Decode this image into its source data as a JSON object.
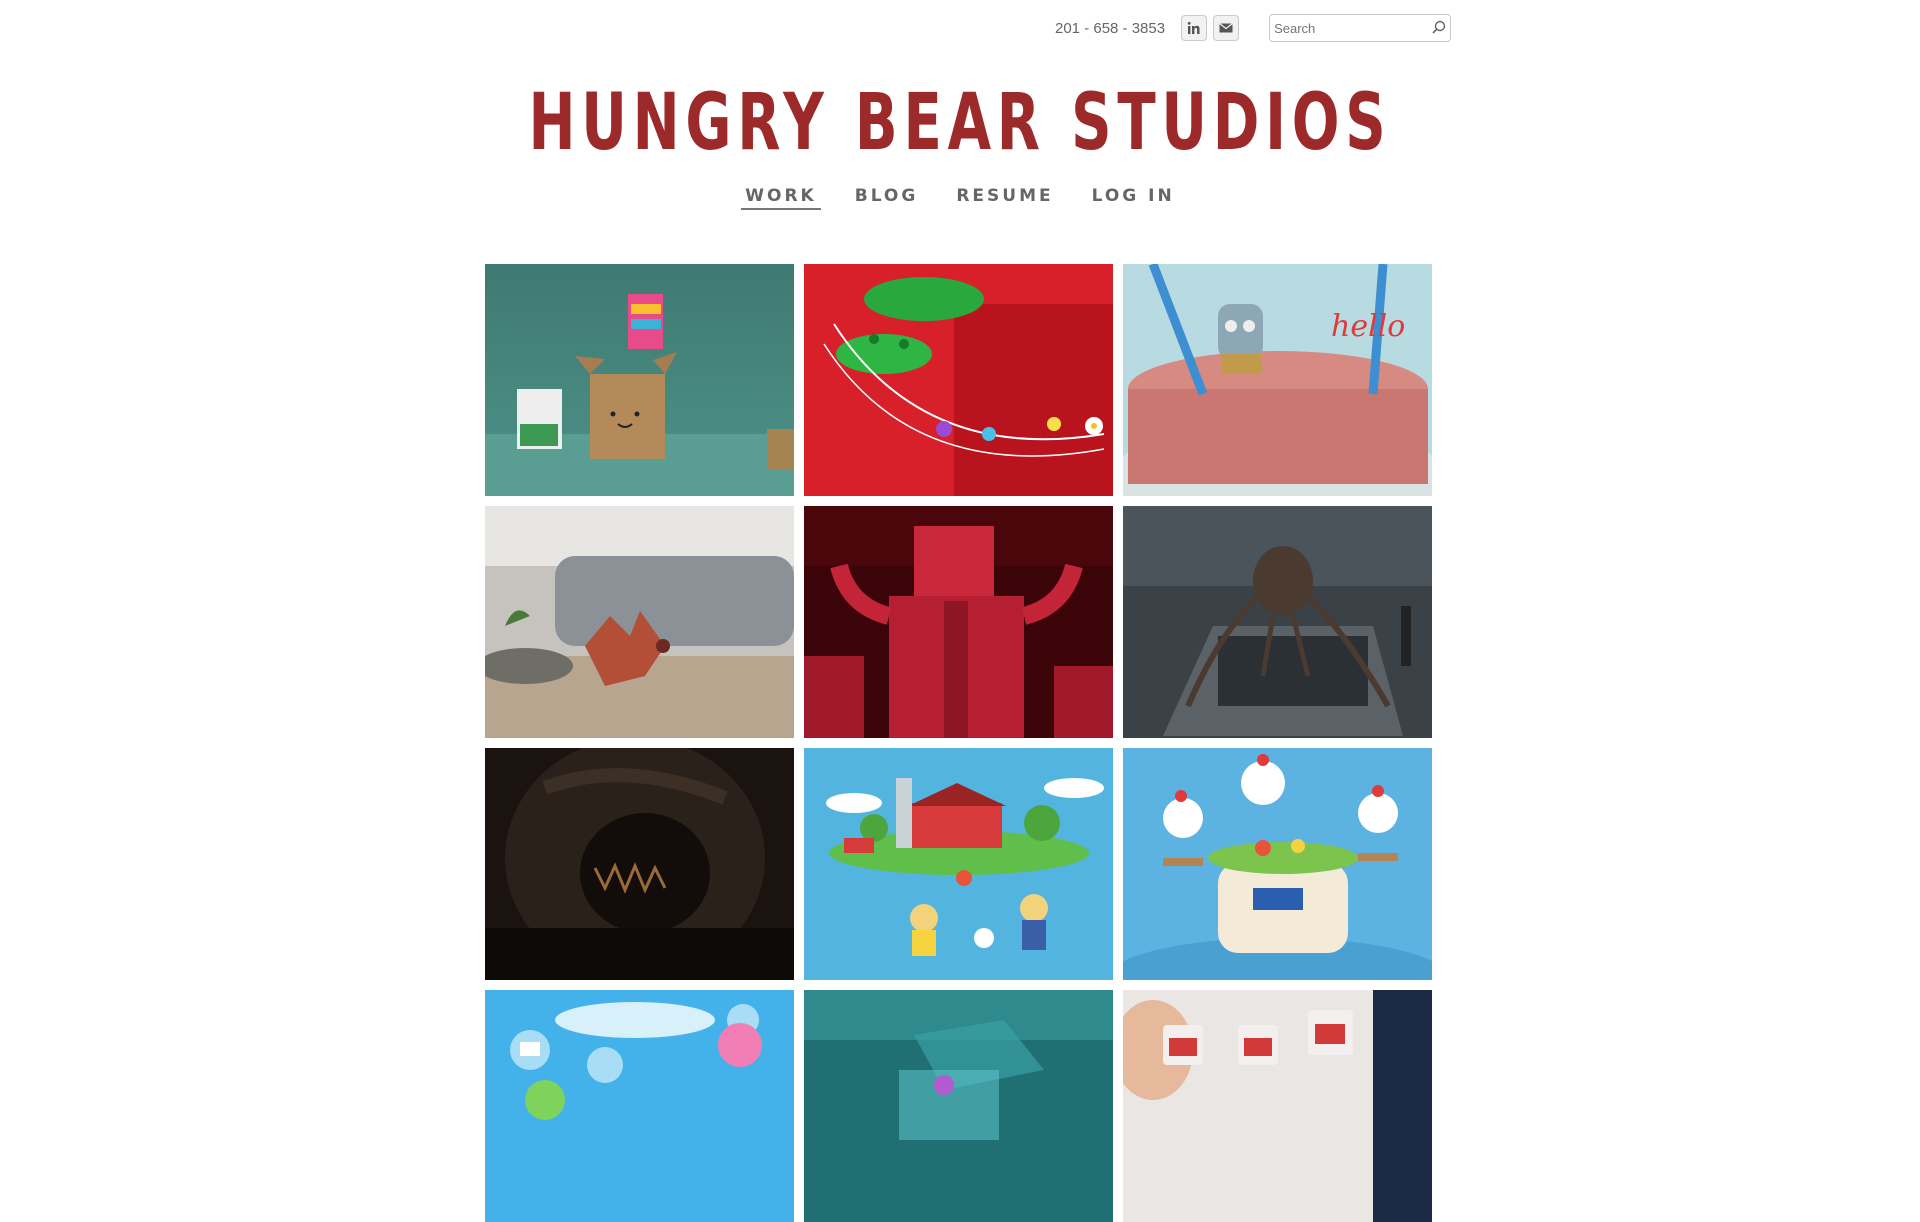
{
  "header": {
    "phone": "201 - 658 - 3853",
    "search_placeholder": "Search",
    "title": "HUNGRY BEAR STUDIOS"
  },
  "nav": {
    "items": [
      {
        "label": "WORK",
        "active": true
      },
      {
        "label": "BLOG",
        "active": false
      },
      {
        "label": "RESUME",
        "active": false
      },
      {
        "label": "LOG IN",
        "active": false
      }
    ]
  },
  "icons": {
    "linkedin": "linkedin-icon",
    "email": "email-icon",
    "search": "search-icon"
  },
  "colors": {
    "title": "#9c2a2a",
    "nav": "#666666"
  }
}
